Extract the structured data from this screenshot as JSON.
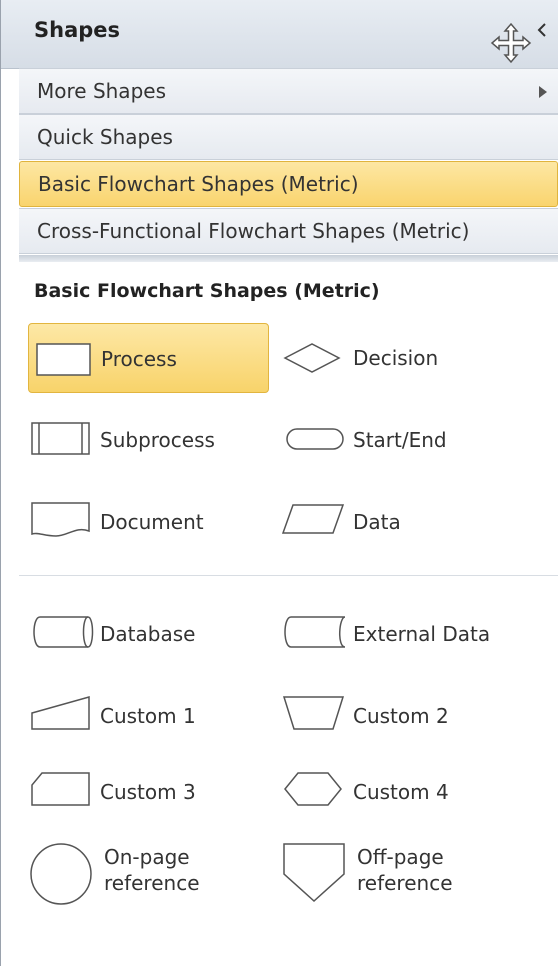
{
  "panel": {
    "title": "Shapes"
  },
  "menu": {
    "more_shapes": "More Shapes",
    "quick_shapes": "Quick Shapes",
    "basic_flowchart": "Basic Flowchart Shapes (Metric)",
    "cross_functional": "Cross-Functional Flowchart Shapes (Metric)",
    "selected": "Basic Flowchart Shapes (Metric)"
  },
  "stencil": {
    "title": "Basic Flowchart Shapes (Metric)",
    "shapes": [
      {
        "label": "Process",
        "icon": "process-shape-icon",
        "selected": true
      },
      {
        "label": "Decision",
        "icon": "decision-shape-icon"
      },
      {
        "label": "Subprocess",
        "icon": "subprocess-shape-icon"
      },
      {
        "label": "Start/End",
        "icon": "start-end-shape-icon"
      },
      {
        "label": "Document",
        "icon": "document-shape-icon"
      },
      {
        "label": "Data",
        "icon": "data-shape-icon"
      },
      {
        "label": "Database",
        "icon": "database-shape-icon"
      },
      {
        "label": "External Data",
        "icon": "external-data-shape-icon"
      },
      {
        "label": "Custom 1",
        "icon": "custom1-shape-icon"
      },
      {
        "label": "Custom 2",
        "icon": "custom2-shape-icon"
      },
      {
        "label": "Custom 3",
        "icon": "custom3-shape-icon"
      },
      {
        "label": "Custom 4",
        "icon": "custom4-shape-icon"
      },
      {
        "label_line1": "On-page",
        "label_line2": "reference",
        "icon": "on-page-reference-shape-icon"
      },
      {
        "label_line1": "Off-page",
        "label_line2": "reference",
        "icon": "off-page-reference-shape-icon"
      }
    ]
  },
  "colors": {
    "highlight": "#f9d46e",
    "highlight_border": "#e0b43d",
    "header_bg": "#d6dde6"
  }
}
